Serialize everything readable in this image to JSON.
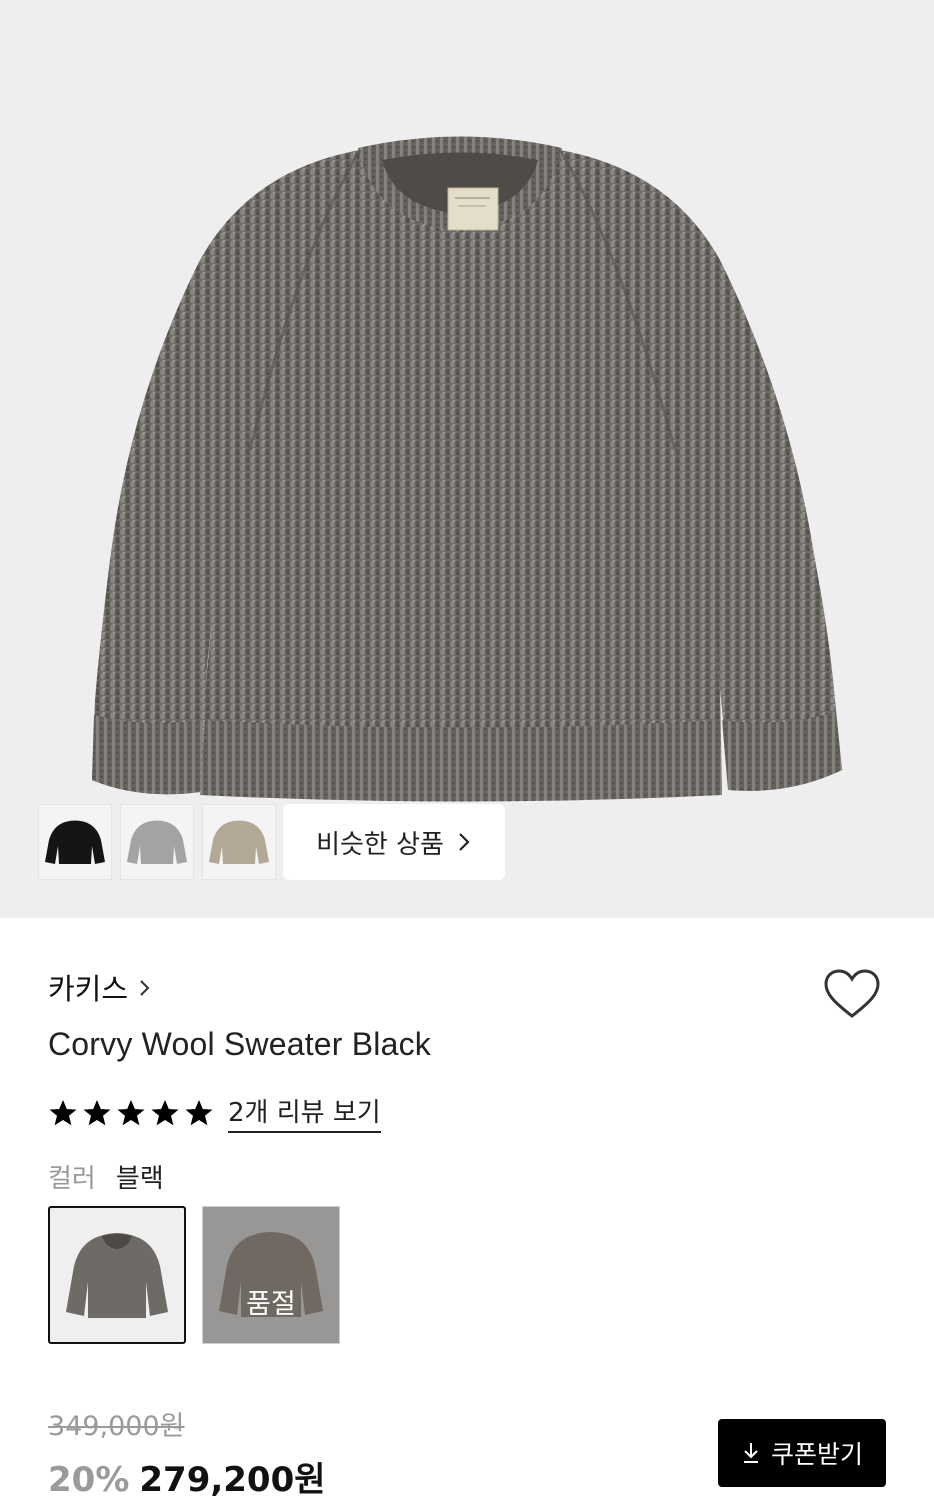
{
  "gallery": {
    "similar_button_label": "비슷한 상품",
    "thumbnails": [
      {
        "icon": "black-sweater-thumbnail"
      },
      {
        "icon": "gray-sweater-thumbnail"
      },
      {
        "icon": "beige-sweater-thumbnail"
      }
    ]
  },
  "product": {
    "brand": "카키스",
    "name": "Corvy Wool Sweater Black",
    "rating_stars": 5,
    "review_link": "2개 리뷰 보기",
    "color_label": "컬러",
    "color_value": "블랙",
    "sold_out_label": "품절"
  },
  "pricing": {
    "original_price": "349,000원",
    "discount": "20%",
    "price": "279,200원",
    "coupon_button": "쿠폰받기"
  },
  "colors": {
    "background_hero": "#eeeeee",
    "sweater_gray": "#6e6a66",
    "button_black": "#000000",
    "muted_text": "#9a9a9a"
  }
}
